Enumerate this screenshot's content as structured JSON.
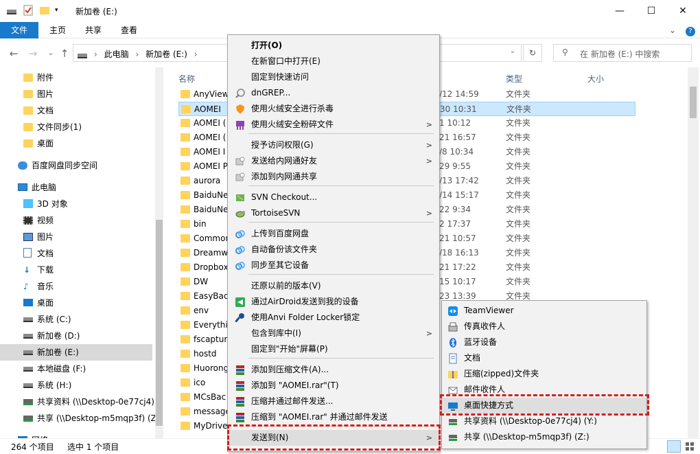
{
  "window": {
    "title": "新加卷 (E:)",
    "minimize": "—",
    "maximize": "☐",
    "close": "✕"
  },
  "ribbon": {
    "tabs": [
      "文件",
      "主页",
      "共享",
      "查看"
    ],
    "expand": "⌄",
    "help": "?"
  },
  "address": {
    "path_pc": "此电脑",
    "sep": "›",
    "path_drive": "新加卷 (E:)",
    "search_placeholder": "在 新加卷 (E:) 中搜索"
  },
  "nav": {
    "items": [
      {
        "label": "附件",
        "icon": "folder-icon"
      },
      {
        "label": "图片",
        "icon": "folder-icon"
      },
      {
        "label": "文档",
        "icon": "folder-icon"
      },
      {
        "label": "文件同步(1)",
        "icon": "folder-icon"
      },
      {
        "label": "桌面",
        "icon": "folder-icon"
      },
      {
        "label": "百度网盘同步空间",
        "icon": "baidu-cloud-icon"
      },
      {
        "label": "此电脑",
        "icon": "pc-icon"
      },
      {
        "label": "3D 对象",
        "icon": "3d-objects-icon"
      },
      {
        "label": "视频",
        "icon": "video-icon"
      },
      {
        "label": "图片",
        "icon": "pictures-icon"
      },
      {
        "label": "文档",
        "icon": "documents-icon"
      },
      {
        "label": "下载",
        "icon": "download-icon"
      },
      {
        "label": "音乐",
        "icon": "music-icon"
      },
      {
        "label": "桌面",
        "icon": "desktop-icon"
      },
      {
        "label": "系统 (C:)",
        "icon": "drive-icon"
      },
      {
        "label": "新加卷 (D:)",
        "icon": "drive-icon"
      },
      {
        "label": "新加卷 (E:)",
        "icon": "drive-icon",
        "selected": true
      },
      {
        "label": "本地磁盘 (F:)",
        "icon": "drive-icon"
      },
      {
        "label": "系统 (H:)",
        "icon": "drive-icon"
      },
      {
        "label": "共享资料 (\\\\Desktop-0e77cj4)",
        "icon": "network-drive-icon"
      },
      {
        "label": "共享 (\\\\Desktop-m5mqp3f) (Z",
        "icon": "network-drive-icon"
      },
      {
        "label": "网络",
        "icon": "network-icon"
      }
    ]
  },
  "columns": {
    "name": "名称",
    "type": "类型",
    "size": "大小"
  },
  "files": [
    {
      "name": "AnyView",
      "date": "/12 14:59",
      "type": "文件夹"
    },
    {
      "name": "AOMEI",
      "date": "30 10:31",
      "type": "文件夹",
      "selected": true
    },
    {
      "name": "AOMEI (",
      "date": "1 10:12",
      "type": "文件夹"
    },
    {
      "name": "AOMEI (",
      "date": "21 16:57",
      "type": "文件夹"
    },
    {
      "name": "AOMEI I",
      "date": "/8 10:34",
      "type": "文件夹"
    },
    {
      "name": "AOMEI P",
      "date": "29 9:55",
      "type": "文件夹"
    },
    {
      "name": "aurora",
      "date": "/13 17:42",
      "type": "文件夹"
    },
    {
      "name": "BaiduNe",
      "date": "/14 15:17",
      "type": "文件夹"
    },
    {
      "name": "BaiduNe",
      "date": "22 9:34",
      "type": "文件夹"
    },
    {
      "name": "bin",
      "date": "2 17:37",
      "type": "文件夹"
    },
    {
      "name": "Common",
      "date": "21 10:57",
      "type": "文件夹"
    },
    {
      "name": "Dreamw",
      "date": "/18 16:13",
      "type": "文件夹"
    },
    {
      "name": "Dropbox",
      "date": "21 17:22",
      "type": "文件夹"
    },
    {
      "name": "DW",
      "date": "15 10:17",
      "type": "文件夹"
    },
    {
      "name": "EasyBac",
      "date": "23 13:39",
      "type": "文件夹"
    },
    {
      "name": "env",
      "date": "",
      "type": ""
    },
    {
      "name": "Everythir",
      "date": "",
      "type": ""
    },
    {
      "name": "fscaptur",
      "date": "",
      "type": ""
    },
    {
      "name": "hostd",
      "date": "",
      "type": ""
    },
    {
      "name": "Huorong",
      "date": "",
      "type": ""
    },
    {
      "name": "ico",
      "date": "",
      "type": ""
    },
    {
      "name": "MCsBac",
      "date": "",
      "type": ""
    },
    {
      "name": "message",
      "date": "",
      "type": ""
    },
    {
      "name": "MyDrive",
      "date": "",
      "type": ""
    }
  ],
  "status": {
    "count": "264 个项目",
    "selected": "选中 1 个项目"
  },
  "context_menu": {
    "items": [
      {
        "label": "打开(O)",
        "bold": true
      },
      {
        "label": "在新窗口中打开(E)"
      },
      {
        "label": "固定到快速访问"
      },
      {
        "label": "dnGREP...",
        "icon": "dngrep-icon"
      },
      {
        "label": "使用火绒安全进行杀毒",
        "icon": "huorong-shield-icon"
      },
      {
        "label": "使用火绒安全粉碎文件",
        "icon": "huorong-shredder-icon",
        "submenu": true
      },
      {
        "label": "授予访问权限(G)",
        "submenu": true
      },
      {
        "label": "发送给内网通好友",
        "icon": "intranet-icon",
        "submenu": true
      },
      {
        "label": "添加到内网通共享",
        "icon": "intranet-icon"
      },
      {
        "label": "SVN Checkout...",
        "icon": "svn-icon"
      },
      {
        "label": "TortoiseSVN",
        "icon": "tortoisesvn-icon",
        "submenu": true
      },
      {
        "label": "上传到百度网盘",
        "icon": "baidu-cloud-icon"
      },
      {
        "label": "自动备份该文件夹",
        "icon": "baidu-cloud-icon"
      },
      {
        "label": "同步至其它设备",
        "icon": "baidu-cloud-icon"
      },
      {
        "label": "还原以前的版本(V)"
      },
      {
        "label": "通过AirDroid发送到我的设备",
        "icon": "airdroid-icon"
      },
      {
        "label": "使用Anvi Folder Locker锁定",
        "icon": "key-icon"
      },
      {
        "label": "包含到库中(I)",
        "submenu": true
      },
      {
        "label": "固定到\"开始\"屏幕(P)"
      },
      {
        "label": "添加到压缩文件(A)...",
        "icon": "winrar-icon"
      },
      {
        "label": "添加到 \"AOMEI.rar\"(T)",
        "icon": "winrar-icon"
      },
      {
        "label": "压缩并通过邮件发送...",
        "icon": "winrar-icon"
      },
      {
        "label": "压缩到 \"AOMEI.rar\" 并通过邮件发送",
        "icon": "winrar-icon"
      },
      {
        "label": "发送到(N)",
        "submenu": true,
        "highlighted": true
      }
    ]
  },
  "sendto_menu": {
    "items": [
      {
        "label": "TeamViewer",
        "icon": "teamviewer-icon"
      },
      {
        "label": "传真收件人",
        "icon": "fax-icon"
      },
      {
        "label": "蓝牙设备",
        "icon": "bluetooth-icon"
      },
      {
        "label": "文档",
        "icon": "documents-icon"
      },
      {
        "label": "压缩(zipped)文件夹",
        "icon": "zip-folder-icon"
      },
      {
        "label": "邮件收件人",
        "icon": "mail-icon"
      },
      {
        "label": "桌面快捷方式",
        "icon": "desktop-icon",
        "highlighted": true
      },
      {
        "label": "共享资料 (\\\\Desktop-0e77cj4) (Y:)",
        "icon": "network-drive-icon"
      },
      {
        "label": "共享 (\\\\Desktop-m5mqp3f) (Z:)",
        "icon": "network-drive-icon"
      }
    ]
  },
  "colors": {
    "accent": "#1979ca",
    "selection": "#cce8ff",
    "highlight_box": "#d41f1f"
  }
}
